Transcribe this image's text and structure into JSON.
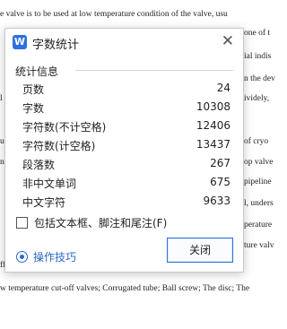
{
  "document": {
    "top_line": "e valve is to be used at low temperature condition of the valve, usu",
    "right_fragments": [
      "one of t",
      "ial indis",
      "n the dev",
      "ividely,",
      "of cryo",
      "op valve",
      "pipeline",
      "l, unders",
      "perature",
      "ture valv"
    ],
    "left_fragments": [
      "l",
      "u",
      "n",
      "ff"
    ],
    "bottom_line": "w temperature cut-off valves; Corrugated tube; Ball screw; The disc; The"
  },
  "dialog": {
    "icon_glyph": "W",
    "title": "字数统计",
    "close_glyph": "✕",
    "section_title": "统计信息",
    "stats": [
      {
        "label": "页数",
        "value": "24"
      },
      {
        "label": "字数",
        "value": "10308"
      },
      {
        "label": "字符数(不计空格)",
        "value": "12406"
      },
      {
        "label": "字符数(计空格)",
        "value": "13437"
      },
      {
        "label": "段落数",
        "value": "267"
      },
      {
        "label": "非中文单词",
        "value": "675"
      },
      {
        "label": "中文字符",
        "value": "9633"
      }
    ],
    "checkbox_label": "包括文本框、脚注和尾注(F)",
    "checkbox_checked": false,
    "tips_label": "操作技巧",
    "close_button_label": "关闭"
  }
}
